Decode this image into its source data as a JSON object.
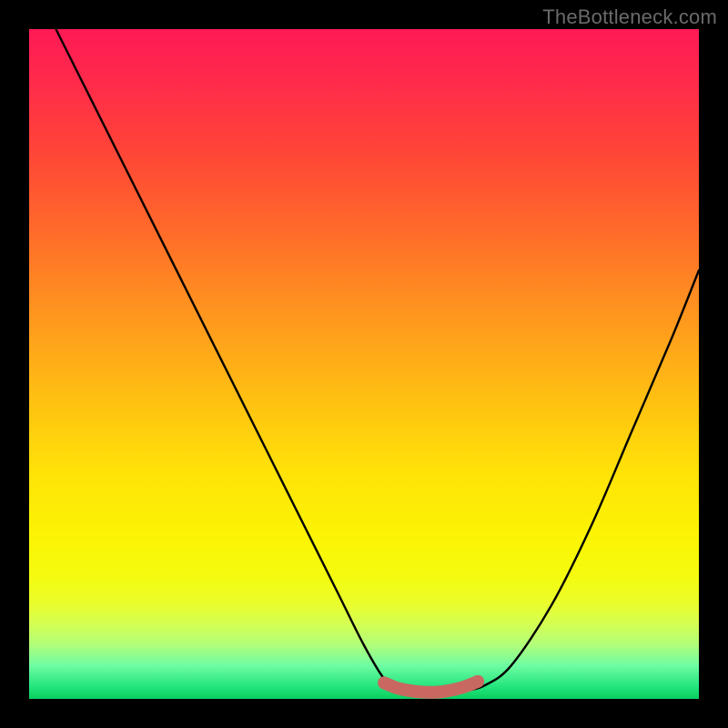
{
  "watermark_text": "TheBottleneck.com",
  "chart_data": {
    "type": "line",
    "title": "",
    "xlabel": "",
    "ylabel": "",
    "xlim": [
      0,
      100
    ],
    "ylim": [
      0,
      100
    ],
    "grid": false,
    "series": [
      {
        "name": "curve",
        "color": "#000000",
        "x": [
          4,
          10,
          16,
          22,
          28,
          34,
          40,
          46,
          50,
          53,
          55,
          57,
          60,
          63,
          65,
          68,
          72,
          78,
          84,
          90,
          96,
          100
        ],
        "y": [
          100,
          88,
          76,
          64,
          52,
          40,
          28,
          16,
          8,
          3,
          1.5,
          1,
          1,
          1,
          1.2,
          2,
          5,
          14,
          26,
          40,
          54,
          64
        ]
      },
      {
        "name": "valley-marker",
        "color": "#c96860",
        "x": [
          53,
          55,
          57,
          59,
          61,
          63,
          65,
          67
        ],
        "y": [
          2.4,
          1.6,
          1.2,
          1.0,
          1.0,
          1.3,
          1.8,
          2.6
        ]
      }
    ],
    "background_gradient_stops": [
      {
        "pos": 0,
        "color": "#ff1a55"
      },
      {
        "pos": 18,
        "color": "#ff4438"
      },
      {
        "pos": 42,
        "color": "#ff941f"
      },
      {
        "pos": 66,
        "color": "#ffe208"
      },
      {
        "pos": 86,
        "color": "#e9fd2e"
      },
      {
        "pos": 100,
        "color": "#09cf5e"
      }
    ]
  }
}
